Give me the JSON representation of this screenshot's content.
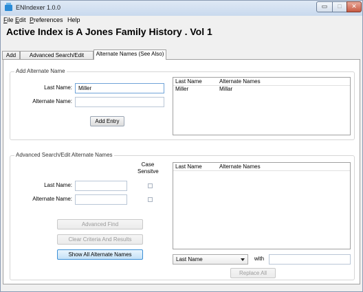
{
  "window": {
    "title": "ENIndexer 1.0.0",
    "min_glyph": "▭",
    "max_glyph": "□",
    "close_glyph": "✕"
  },
  "menu": [
    {
      "accel": "F",
      "rest": "ile"
    },
    {
      "accel": "E",
      "rest": "dit"
    },
    {
      "accel": "P",
      "rest": "references"
    },
    {
      "accel": "",
      "rest": "Help"
    }
  ],
  "active_index_text": "Active Index is A Jones Family History . Vol 1",
  "tabs": [
    "Add",
    "Advanced Search/Edit",
    "Alternate Names (See Also)"
  ],
  "add_group": {
    "title": "Add Alternate Name",
    "last_name_label": "Last Name:",
    "last_name_value": "Miller",
    "alternate_name_label": "Alternate Name:",
    "alternate_name_value": "",
    "add_button": "Add Entry",
    "list_columns": [
      "Last Name",
      "Alternate Names"
    ],
    "list_rows": [
      {
        "last": "Miller",
        "alternate": "Millar"
      }
    ]
  },
  "search_group": {
    "title": "Advanced Search/Edit Alternate Names",
    "case_sensitive_label": "Case Sensitve",
    "last_name_label": "Last Name:",
    "last_name_value": "",
    "alternate_name_label": "Alternate Name:",
    "alternate_name_value": "",
    "advanced_find_button": "Advanced Find",
    "clear_button": "Clear Criteria  And Results",
    "show_all_button": "Show All Alternate Names",
    "list_columns": [
      "Last Name",
      "Alternate Names"
    ],
    "replace_field_selected": "Last Name",
    "with_label": "with",
    "replace_value": "",
    "replace_all_button": "Replace All"
  }
}
